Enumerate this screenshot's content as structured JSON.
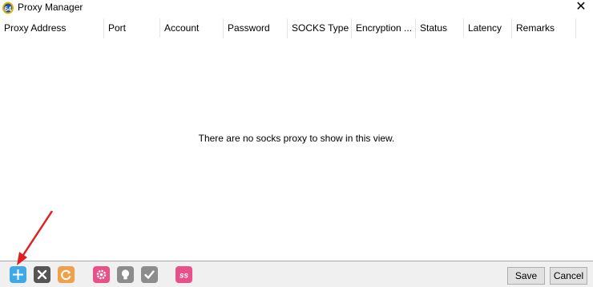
{
  "window": {
    "title": "Proxy Manager",
    "close_glyph": "✕"
  },
  "table": {
    "columns": [
      "Proxy Address",
      "Port",
      "Account",
      "Password",
      "SOCKS Type",
      "Encryption ...",
      "Status",
      "Latency",
      "Remarks"
    ],
    "empty_message": "There are no socks proxy to show in this view."
  },
  "toolbar": {
    "icons": [
      {
        "name": "add-icon",
        "color": "#3fa9e7"
      },
      {
        "name": "delete-icon",
        "color": "#555555"
      },
      {
        "name": "refresh-icon",
        "color": "#f0a04b"
      },
      {
        "name": "settings-icon",
        "color": "#e8508a"
      },
      {
        "name": "lightbulb-icon",
        "color": "#8c8c8c"
      },
      {
        "name": "check-icon",
        "color": "#8c8c8c"
      },
      {
        "name": "shadowsocks-icon",
        "color": "#e8508a",
        "text": "ss"
      }
    ]
  },
  "buttons": {
    "save": "Save",
    "cancel": "Cancel"
  },
  "annotation": {
    "arrow_color": "#e02020"
  }
}
